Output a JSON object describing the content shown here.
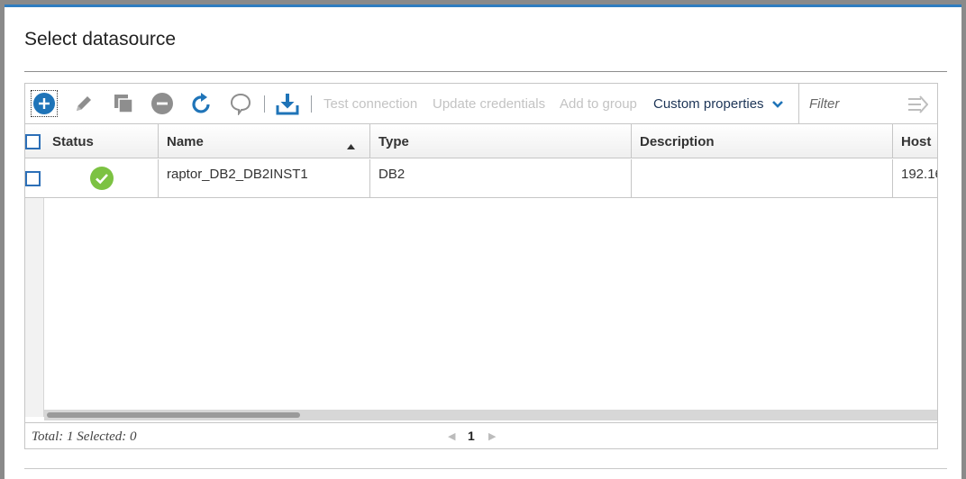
{
  "dialog": {
    "title": "Select datasource"
  },
  "toolbar": {
    "icons": [
      "add-icon",
      "edit-icon",
      "copy-icon",
      "remove-icon",
      "refresh-icon",
      "comment-icon",
      "download-icon"
    ],
    "test_connection": "Test connection",
    "update_credentials": "Update credentials",
    "add_to_group": "Add to group",
    "custom_properties": "Custom properties",
    "filter_placeholder": "Filter"
  },
  "grid": {
    "columns": [
      "Status",
      "Name",
      "Type",
      "Description",
      "Host"
    ],
    "sorted_column": "Name",
    "sort_direction": "ascending",
    "rows": [
      {
        "status": "ok",
        "name": "raptor_DB2_DB2INST1",
        "type": "DB2",
        "description": "",
        "host": "192.16"
      }
    ]
  },
  "footer": {
    "summary": "Total: 1 Selected: 0",
    "current_page": "1"
  },
  "colors": {
    "accent": "#2f7dc1",
    "icon_blue": "#1f74b8",
    "icon_gray": "#8e8e8e",
    "status_ok": "#7cc242",
    "link_dark": "#1d3557"
  }
}
